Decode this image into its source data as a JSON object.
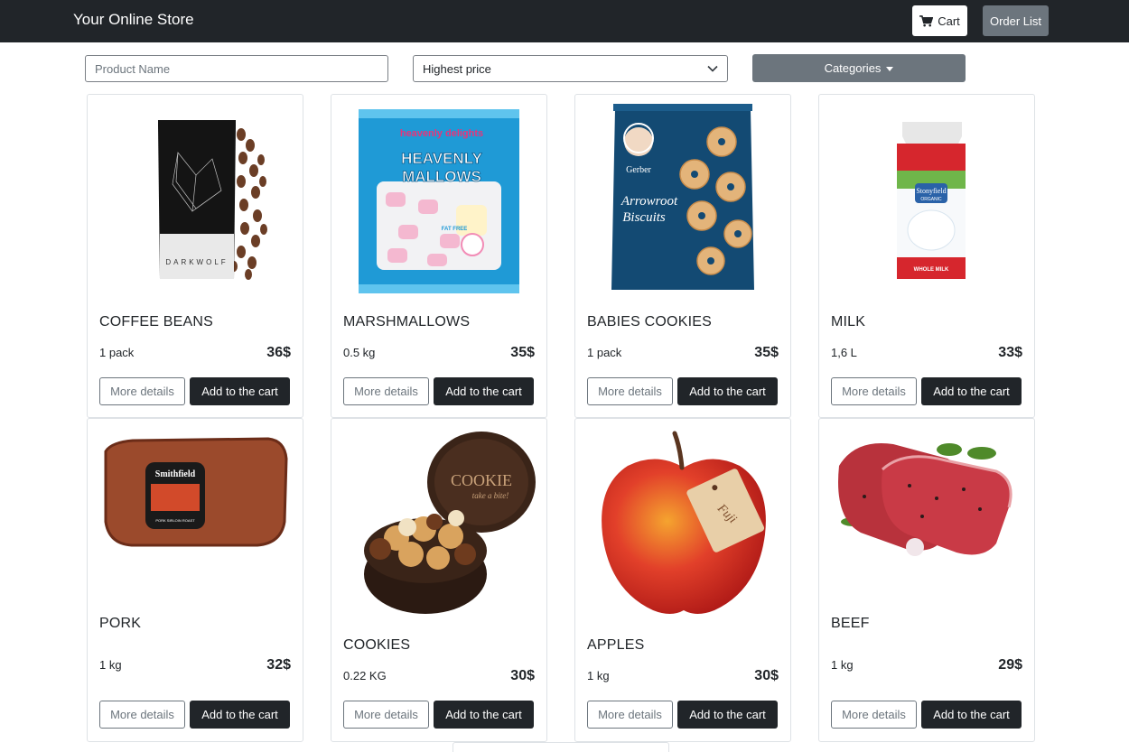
{
  "navbar": {
    "brand": "Your Online Store",
    "cart_label": "Cart",
    "orders_label": "Order List"
  },
  "filters": {
    "search_placeholder": "Product Name",
    "sort_value": "Highest price",
    "categories_label": "Categories"
  },
  "products": [
    {
      "name": "COFFEE BEANS",
      "qty": "1 pack",
      "price": "36$",
      "details_label": "More details",
      "add_label": "Add to the cart",
      "image": "coffee-bag-icon"
    },
    {
      "name": "MARSHMALLOWS",
      "qty": "0.5 kg",
      "price": "35$",
      "details_label": "More details",
      "add_label": "Add to the cart",
      "image": "marshmallow-bag-icon"
    },
    {
      "name": "BABIES COOKIES",
      "qty": "1 pack",
      "price": "35$",
      "details_label": "More details",
      "add_label": "Add to the cart",
      "image": "biscuit-bag-icon"
    },
    {
      "name": "MILK",
      "qty": "1,6 L",
      "price": "33$",
      "details_label": "More details",
      "add_label": "Add to the cart",
      "image": "milk-carton-icon"
    },
    {
      "name": "PORK",
      "qty": "1 kg",
      "price": "32$",
      "details_label": "More details",
      "add_label": "Add to the cart",
      "image": "pork-roast-icon"
    },
    {
      "name": "COOKIES",
      "qty": "0.22 KG",
      "price": "30$",
      "details_label": "More details",
      "add_label": "Add to the cart",
      "image": "cookie-tin-icon"
    },
    {
      "name": "APPLES",
      "qty": "1 kg",
      "price": "30$",
      "details_label": "More details",
      "add_label": "Add to the cart",
      "image": "apple-icon"
    },
    {
      "name": "BEEF",
      "qty": "1 kg",
      "price": "29$",
      "details_label": "More details",
      "add_label": "Add to the cart",
      "image": "beef-steak-icon"
    }
  ],
  "image_text": {
    "coffee_brand": "DARKWOLF",
    "marshmallow_brand_top": "heavenly delights",
    "marshmallow_brand": "HEAVENLY MALLOWS",
    "marshmallow_badge": "FAT FREE",
    "biscuit_brand": "Gerber",
    "biscuit_name": "Arrowroot Biscuits",
    "milk_brand": "Stonyfield",
    "milk_sub": "ORGANIC",
    "milk_label": "WHOLE MILK",
    "pork_brand": "Smithfield",
    "pork_label": "PORK SIRLOIN ROAST",
    "cookie_brand": "COOKIE",
    "cookie_tag": "take a bite!",
    "apple_tag": "Fuji"
  },
  "colors": {
    "navbar": "#212529",
    "secondary": "#6c757d",
    "dark_button": "#212529"
  }
}
